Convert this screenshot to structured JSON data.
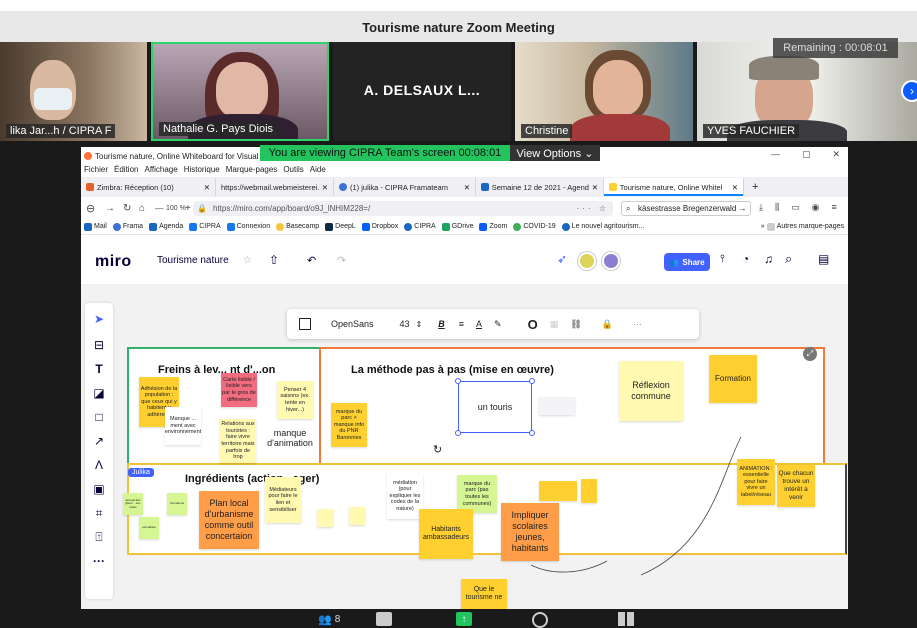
{
  "zoom": {
    "title": "Tourisme nature  Zoom Meeting",
    "remaining": "Remaining : 00:08:01",
    "viewing_banner": "You are viewing CIPRA Team's screen 00:08:01",
    "view_options": "View Options ⌄",
    "participants_count": "8"
  },
  "participants": [
    {
      "name": "lika Jar...h / CIPRA F"
    },
    {
      "name": "Nathalie G. Pays Diois"
    },
    {
      "name": "A. DELSAUX L..."
    },
    {
      "name": "Christine"
    },
    {
      "name": "YVES FAUCHIER"
    }
  ],
  "firefox": {
    "window_title": "Tourisme nature, Online Whiteboard for Visual Co",
    "menu": [
      "Fichier",
      "Édition",
      "Affichage",
      "Historique",
      "Marque-pages",
      "Outils",
      "Aide"
    ],
    "tabs": [
      {
        "label": "Zimbra: Réception (10)",
        "color": "#e2622b"
      },
      {
        "label": "https://webmail.webmeisterei.com",
        "color": "#888888"
      },
      {
        "label": "(1) julika - CIPRA Framateam",
        "color": "#3b74d6"
      },
      {
        "label": "Semaine 12 de 2021 - Agenda",
        "color": "#1a66c2"
      },
      {
        "label": "Tourisme nature, Online Whitel",
        "color": "#ffd02f"
      }
    ],
    "zoom_level": "100 %",
    "url": "https://miro.com/app/board/o9J_lNHIM228=/",
    "search": "käsestrasse Bregenzerwald →",
    "more_bookmarks": "Autres marque-pages",
    "bookmarks": [
      {
        "label": "Mail",
        "color": "#1a66c2"
      },
      {
        "label": "Frama",
        "color": "#3b74d6"
      },
      {
        "label": "Agenda",
        "color": "#1a66c2"
      },
      {
        "label": "CIPRA",
        "color": "#1877f2"
      },
      {
        "label": "Connexion",
        "color": "#1877f2"
      },
      {
        "label": "Basecamp",
        "color": "#1d2d35"
      },
      {
        "label": "DeepL",
        "color": "#0f2b46"
      },
      {
        "label": "Dropbox",
        "color": "#0061ff"
      },
      {
        "label": "CIPRA",
        "color": "#1a66c2"
      },
      {
        "label": "GDrive",
        "color": "#1fa463"
      },
      {
        "label": "Zoom",
        "color": "#0b5cff"
      },
      {
        "label": "COVID-19",
        "color": "#3cae5a"
      },
      {
        "label": "Le nouvel agritourism...",
        "color": "#1a66c2"
      }
    ]
  },
  "miro": {
    "logo": "miro",
    "board_name": "Tourisme nature",
    "share": "Share",
    "font": "OpenSans",
    "font_size": "43",
    "more": "···"
  },
  "board": {
    "frame1_title": "Freins à lev... nt d'...on",
    "frame2_title": "La méthode pas à pas (mise en œuvre)",
    "frame3_title": "Ingrédients (action...ager)",
    "julika_tag": "Julika",
    "manque": "manque d'animation",
    "un_touris": "un touris",
    "stickies": [
      {
        "text": "Adhésion de la population : que ceux qui y habitent y adhèrent.",
        "color": "#ffd02f"
      },
      {
        "text": "Carte lisible / lisible vers par le gros de différence",
        "color": "#f16c7f"
      },
      {
        "text": "Penser 4 saisons (ex. tente en hiver...)",
        "color": "#fff9b1"
      },
      {
        "text": "Relations aux touristes : faire vivre territoire mais parfois de trop",
        "color": "#fff9b1"
      },
      {
        "text": "Manque ... ment avec environnement",
        "color": "#ffffff"
      },
      {
        "text": "marque du parc > manque info du PNR Baronnies",
        "color": "#ffd02f"
      },
      {
        "text": "Réflexion commune",
        "color": "#fff9b1"
      },
      {
        "text": "Formation",
        "color": "#ffd02f"
      },
      {
        "text": "ANIMATION : essentielle pour faire vivre un label/réseau",
        "color": "#ffd02f"
      },
      {
        "text": "Que chacun trouve un intérêt à venir",
        "color": "#ffd02f"
      },
      {
        "text": "médiation (pour expliquer les codes de la nature)",
        "color": "#ffffff"
      },
      {
        "text": "marque du parc (pas toutes les communes)",
        "color": "#d5f692"
      },
      {
        "text": "Plan local d'urbanisme comme outil concertaion",
        "color": "#ff9d48"
      },
      {
        "text": "Médiateurs pour faire le lien et sensibiliser",
        "color": "#fff9b1"
      },
      {
        "text": "Habitants ambassadeurs",
        "color": "#ffd02f"
      },
      {
        "text": "Impliquer scolaires jeunes, habitants",
        "color": "#ff9d48"
      },
      {
        "text": "Que le tourisme ne",
        "color": "#ffd02f"
      },
      {
        "text": "accueil des gîtes/... tou-ristes",
        "color": "#d5f692"
      },
      {
        "text": "formations",
        "color": "#d5f692"
      },
      {
        "text": "éco-labels",
        "color": "#d5f692"
      }
    ]
  }
}
